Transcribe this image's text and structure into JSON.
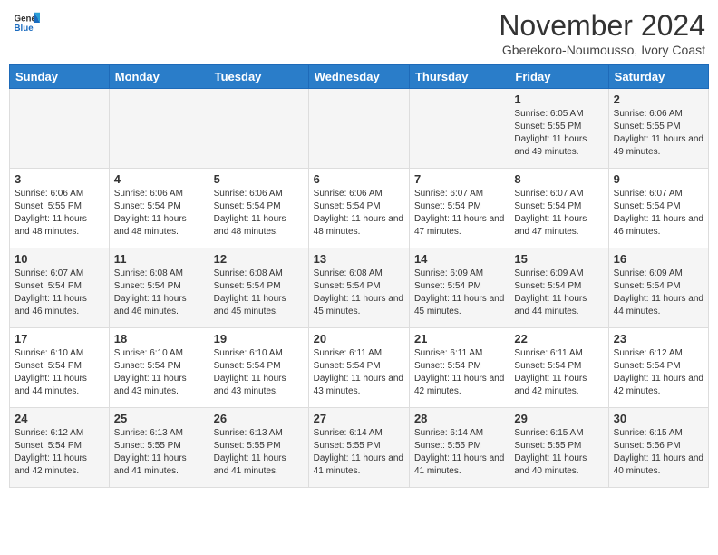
{
  "header": {
    "logo_general": "General",
    "logo_blue": "Blue",
    "month": "November 2024",
    "location": "Gberekoro-Noumousso, Ivory Coast"
  },
  "days_of_week": [
    "Sunday",
    "Monday",
    "Tuesday",
    "Wednesday",
    "Thursday",
    "Friday",
    "Saturday"
  ],
  "weeks": [
    [
      {
        "day": "",
        "info": ""
      },
      {
        "day": "",
        "info": ""
      },
      {
        "day": "",
        "info": ""
      },
      {
        "day": "",
        "info": ""
      },
      {
        "day": "",
        "info": ""
      },
      {
        "day": "1",
        "info": "Sunrise: 6:05 AM\nSunset: 5:55 PM\nDaylight: 11 hours and 49 minutes."
      },
      {
        "day": "2",
        "info": "Sunrise: 6:06 AM\nSunset: 5:55 PM\nDaylight: 11 hours and 49 minutes."
      }
    ],
    [
      {
        "day": "3",
        "info": "Sunrise: 6:06 AM\nSunset: 5:55 PM\nDaylight: 11 hours and 48 minutes."
      },
      {
        "day": "4",
        "info": "Sunrise: 6:06 AM\nSunset: 5:54 PM\nDaylight: 11 hours and 48 minutes."
      },
      {
        "day": "5",
        "info": "Sunrise: 6:06 AM\nSunset: 5:54 PM\nDaylight: 11 hours and 48 minutes."
      },
      {
        "day": "6",
        "info": "Sunrise: 6:06 AM\nSunset: 5:54 PM\nDaylight: 11 hours and 48 minutes."
      },
      {
        "day": "7",
        "info": "Sunrise: 6:07 AM\nSunset: 5:54 PM\nDaylight: 11 hours and 47 minutes."
      },
      {
        "day": "8",
        "info": "Sunrise: 6:07 AM\nSunset: 5:54 PM\nDaylight: 11 hours and 47 minutes."
      },
      {
        "day": "9",
        "info": "Sunrise: 6:07 AM\nSunset: 5:54 PM\nDaylight: 11 hours and 46 minutes."
      }
    ],
    [
      {
        "day": "10",
        "info": "Sunrise: 6:07 AM\nSunset: 5:54 PM\nDaylight: 11 hours and 46 minutes."
      },
      {
        "day": "11",
        "info": "Sunrise: 6:08 AM\nSunset: 5:54 PM\nDaylight: 11 hours and 46 minutes."
      },
      {
        "day": "12",
        "info": "Sunrise: 6:08 AM\nSunset: 5:54 PM\nDaylight: 11 hours and 45 minutes."
      },
      {
        "day": "13",
        "info": "Sunrise: 6:08 AM\nSunset: 5:54 PM\nDaylight: 11 hours and 45 minutes."
      },
      {
        "day": "14",
        "info": "Sunrise: 6:09 AM\nSunset: 5:54 PM\nDaylight: 11 hours and 45 minutes."
      },
      {
        "day": "15",
        "info": "Sunrise: 6:09 AM\nSunset: 5:54 PM\nDaylight: 11 hours and 44 minutes."
      },
      {
        "day": "16",
        "info": "Sunrise: 6:09 AM\nSunset: 5:54 PM\nDaylight: 11 hours and 44 minutes."
      }
    ],
    [
      {
        "day": "17",
        "info": "Sunrise: 6:10 AM\nSunset: 5:54 PM\nDaylight: 11 hours and 44 minutes."
      },
      {
        "day": "18",
        "info": "Sunrise: 6:10 AM\nSunset: 5:54 PM\nDaylight: 11 hours and 43 minutes."
      },
      {
        "day": "19",
        "info": "Sunrise: 6:10 AM\nSunset: 5:54 PM\nDaylight: 11 hours and 43 minutes."
      },
      {
        "day": "20",
        "info": "Sunrise: 6:11 AM\nSunset: 5:54 PM\nDaylight: 11 hours and 43 minutes."
      },
      {
        "day": "21",
        "info": "Sunrise: 6:11 AM\nSunset: 5:54 PM\nDaylight: 11 hours and 42 minutes."
      },
      {
        "day": "22",
        "info": "Sunrise: 6:11 AM\nSunset: 5:54 PM\nDaylight: 11 hours and 42 minutes."
      },
      {
        "day": "23",
        "info": "Sunrise: 6:12 AM\nSunset: 5:54 PM\nDaylight: 11 hours and 42 minutes."
      }
    ],
    [
      {
        "day": "24",
        "info": "Sunrise: 6:12 AM\nSunset: 5:54 PM\nDaylight: 11 hours and 42 minutes."
      },
      {
        "day": "25",
        "info": "Sunrise: 6:13 AM\nSunset: 5:55 PM\nDaylight: 11 hours and 41 minutes."
      },
      {
        "day": "26",
        "info": "Sunrise: 6:13 AM\nSunset: 5:55 PM\nDaylight: 11 hours and 41 minutes."
      },
      {
        "day": "27",
        "info": "Sunrise: 6:14 AM\nSunset: 5:55 PM\nDaylight: 11 hours and 41 minutes."
      },
      {
        "day": "28",
        "info": "Sunrise: 6:14 AM\nSunset: 5:55 PM\nDaylight: 11 hours and 41 minutes."
      },
      {
        "day": "29",
        "info": "Sunrise: 6:15 AM\nSunset: 5:55 PM\nDaylight: 11 hours and 40 minutes."
      },
      {
        "day": "30",
        "info": "Sunrise: 6:15 AM\nSunset: 5:56 PM\nDaylight: 11 hours and 40 minutes."
      }
    ]
  ]
}
